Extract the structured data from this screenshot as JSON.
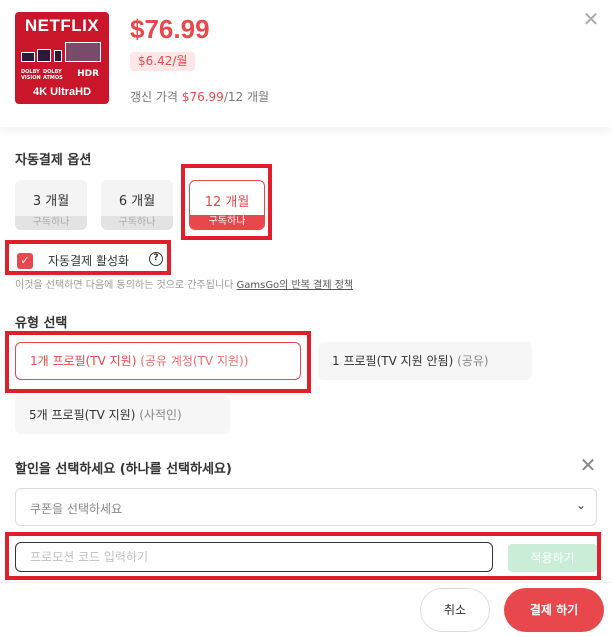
{
  "product": {
    "brand": "NETFLIX",
    "format_tags": [
      "DOLBY VISION",
      "DOLBY ATMOS",
      "HDR"
    ],
    "quality": "4K UltraHD"
  },
  "price": {
    "main": "$76.99",
    "monthly": "$6.42/월",
    "renew_label": "갱신 가격",
    "renew_price": "$76.99",
    "renew_period": "/12 개월"
  },
  "autopay": {
    "title": "자동결제 옵션",
    "options": [
      {
        "label": "3 개월",
        "sub": "구독하나",
        "active": false
      },
      {
        "label": "6 개월",
        "sub": "구독하나",
        "active": false
      },
      {
        "label": "12 개월",
        "sub": "구독하나",
        "active": true
      }
    ],
    "enable_label": "자동결제 활성화",
    "enabled": true,
    "notice_prefix": "이것을 선택하면 다음에 동의하는 것으로 간주됩니다 ",
    "notice_link": "GamsGo의 반복 결제 정책"
  },
  "type": {
    "title": "유형 선택",
    "options": [
      {
        "main": "1개 프로필(TV 지원)",
        "sub": "(공유 계정(TV 지원))",
        "active": true
      },
      {
        "main": "1 프로필(TV 지원 안됨)",
        "sub": "(공유)",
        "active": false
      },
      {
        "main": "5개 프로필(TV 지원)",
        "sub": "(사적인)",
        "active": false
      }
    ]
  },
  "coupon": {
    "title": "할인을 선택하세요 (하나를 선택하세요)",
    "select_placeholder": "쿠폰을 선택하세요",
    "promo_placeholder": "프로모션 코드 입력하기",
    "apply_label": "적용하기"
  },
  "footer": {
    "cancel_label": "취소",
    "pay_label": "결제 하기"
  },
  "colors": {
    "accent": "#e8484b",
    "highlight_box": "#e01e2c",
    "apply_disabled": "#c9edd6"
  }
}
